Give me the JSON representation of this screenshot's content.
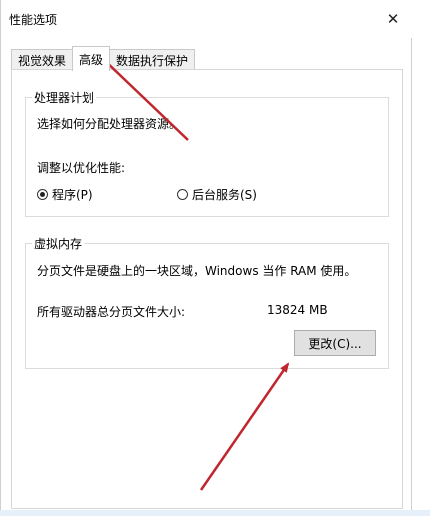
{
  "window": {
    "title": "性能选项"
  },
  "tabs": [
    {
      "label": "视觉效果"
    },
    {
      "label": "高级"
    },
    {
      "label": "数据执行保护"
    }
  ],
  "processor": {
    "group_label": "处理器计划",
    "description": "选择如何分配处理器资源。",
    "adjust_label": "调整以优化性能:",
    "options": [
      {
        "label": "程序(P)",
        "checked": true
      },
      {
        "label": "后台服务(S)",
        "checked": false
      }
    ]
  },
  "virtual_memory": {
    "group_label": "虚拟内存",
    "description": "分页文件是硬盘上的一块区域，Windows 当作 RAM 使用。",
    "total_label": "所有驱动器总分页文件大小:",
    "total_value": "13824 MB",
    "change_button": "更改(C)..."
  },
  "colors": {
    "annotation_arrow": "#c0262d"
  }
}
